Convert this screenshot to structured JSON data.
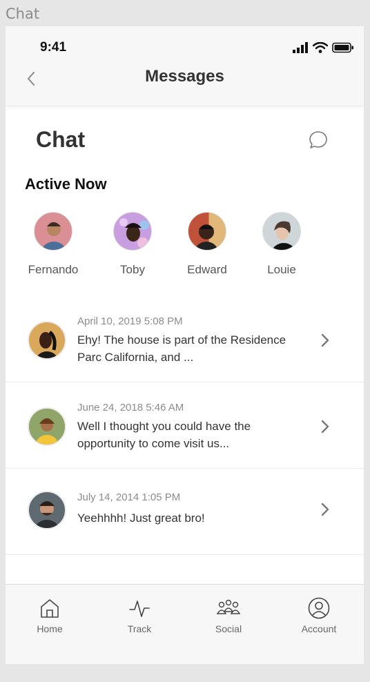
{
  "frame_label": "Chat",
  "status": {
    "time": "9:41"
  },
  "nav": {
    "title": "Messages"
  },
  "page": {
    "title": "Chat"
  },
  "active": {
    "title": "Active Now",
    "friends": [
      {
        "name": "Fernando",
        "color": "#d98f93"
      },
      {
        "name": "Toby",
        "color": "#c99ee0"
      },
      {
        "name": "Edward",
        "color": "#c0523a"
      },
      {
        "name": "Louie",
        "color": "#cfd6d9"
      }
    ]
  },
  "messages": [
    {
      "date": "April 10, 2019 5:08 PM",
      "text": "Ehy! The house is part of the Residence Parc California, and ...",
      "color": "#d9a85a"
    },
    {
      "date": "June 24, 2018 5:46 AM",
      "text": "Well I thought you could have the opportunity to come visit us...",
      "color": "#b9913f"
    },
    {
      "date": "July 14, 2014 1:05 PM",
      "text": "Yeehhhh! Just great bro!",
      "color": "#5e6a70"
    }
  ],
  "tabs": [
    {
      "label": "Home",
      "icon": "home-icon"
    },
    {
      "label": "Track",
      "icon": "activity-icon"
    },
    {
      "label": "Social",
      "icon": "people-icon"
    },
    {
      "label": "Account",
      "icon": "account-icon"
    }
  ]
}
